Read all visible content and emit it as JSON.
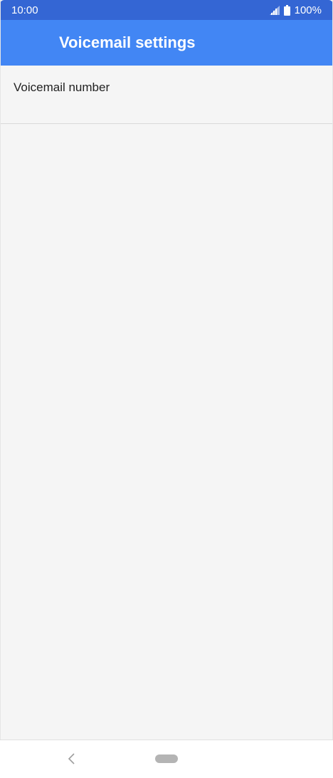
{
  "status_bar": {
    "time": "10:00",
    "battery": "100%",
    "icons": [
      "signal-icon",
      "battery-icon"
    ]
  },
  "app_bar": {
    "title": "Voicemail settings"
  },
  "settings": {
    "items": [
      {
        "label": "Voicemail number"
      }
    ]
  },
  "nav_bar": {
    "icons": [
      "back-icon",
      "home-pill-icon"
    ]
  },
  "colors": {
    "status_bar": "#3466d4",
    "app_bar": "#4286f4",
    "background": "#f5f5f5",
    "nav_bar": "#ffffff"
  }
}
